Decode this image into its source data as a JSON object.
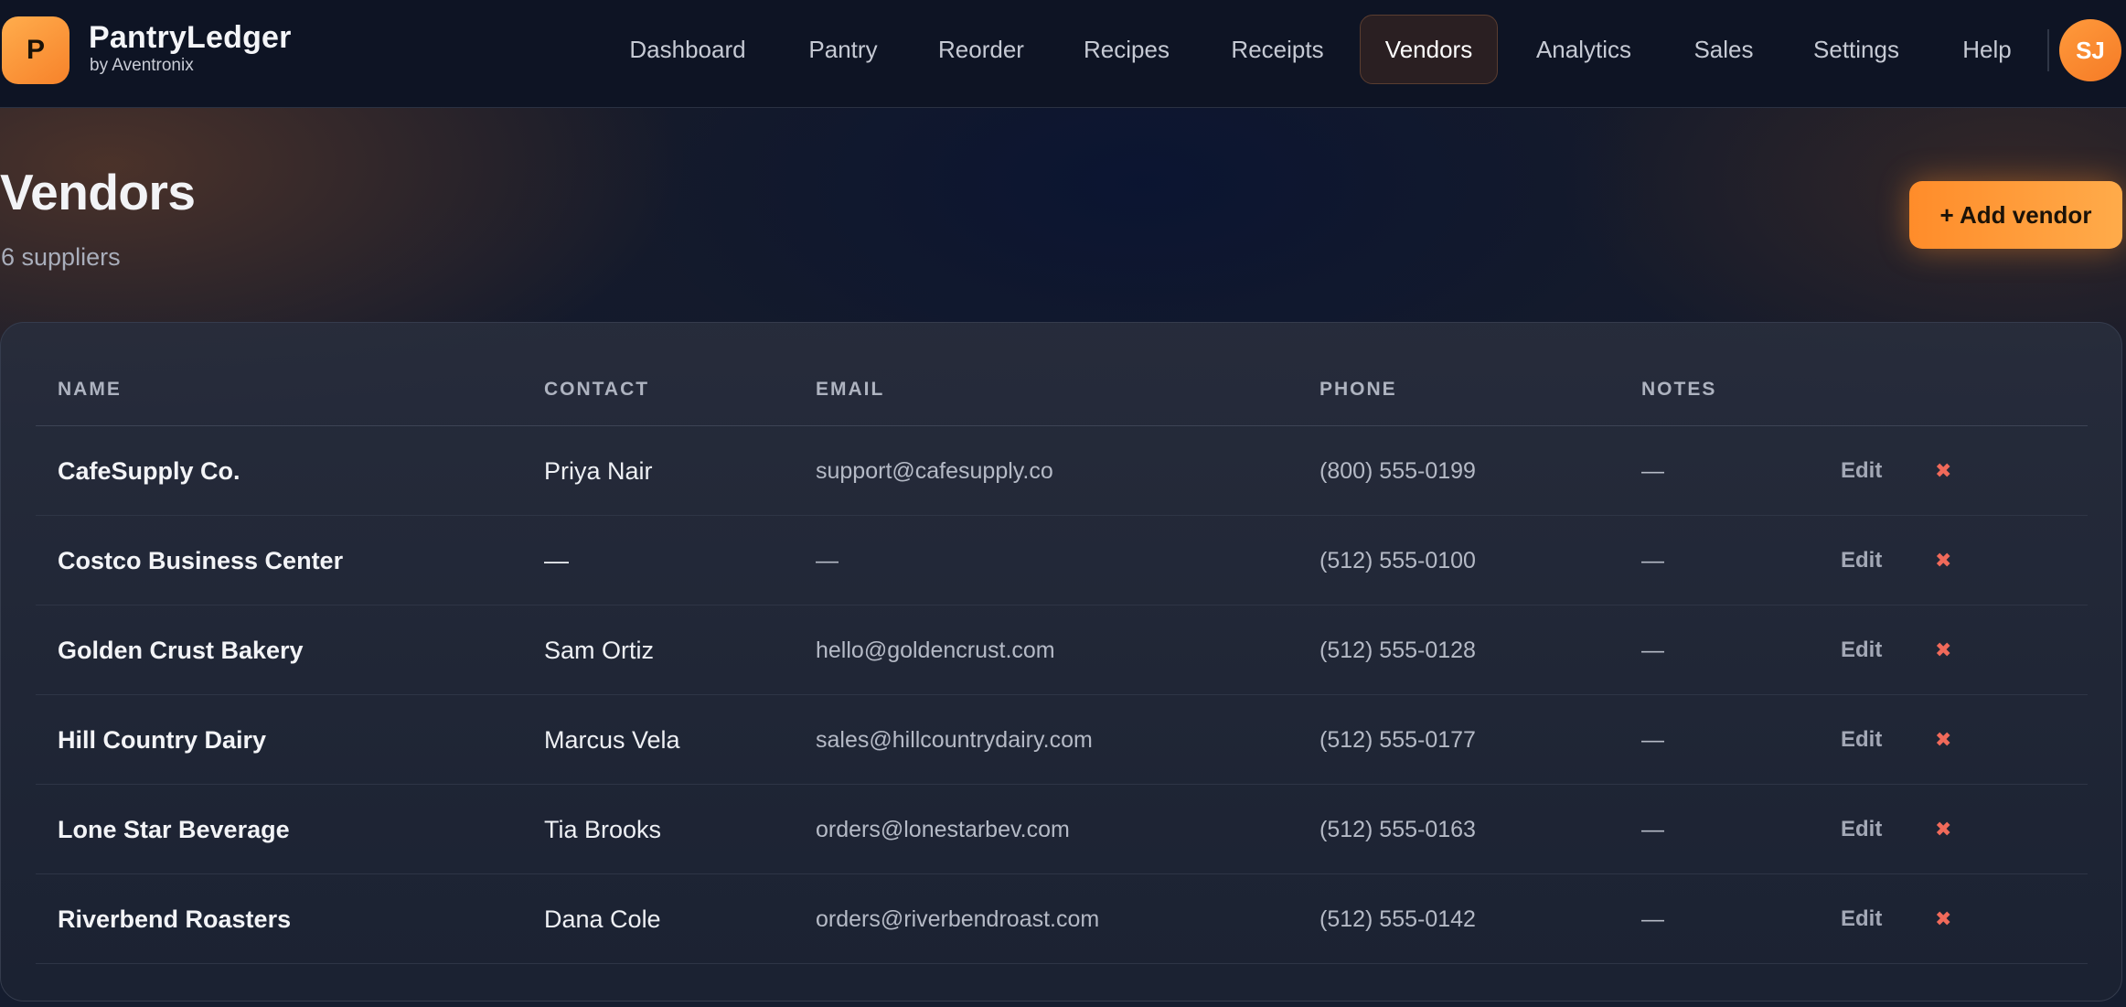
{
  "brand": {
    "logo_letter": "P",
    "name": "PantryLedger",
    "byline": "by Aventronix",
    "accent_color": "#f7822a"
  },
  "nav": {
    "items": [
      {
        "label": "Dashboard"
      },
      {
        "label": "Pantry"
      },
      {
        "label": "Reorder"
      },
      {
        "label": "Recipes"
      },
      {
        "label": "Receipts"
      },
      {
        "label": "Vendors",
        "active": true
      },
      {
        "label": "Analytics"
      },
      {
        "label": "Sales"
      },
      {
        "label": "Settings"
      },
      {
        "label": "Help"
      }
    ],
    "avatar_initials": "SJ"
  },
  "page": {
    "title": "Vendors",
    "subtitle": "6 suppliers",
    "add_button_label": "+ Add vendor"
  },
  "table": {
    "headers": {
      "name": "NAME",
      "contact": "CONTACT",
      "email": "EMAIL",
      "phone": "PHONE",
      "notes": "NOTES"
    },
    "edit_label": "Edit",
    "delete_icon": "close-icon",
    "delete_glyph": "✖",
    "rows": [
      {
        "name": "CafeSupply Co.",
        "contact": "Priya Nair",
        "email": "support@cafesupply.co",
        "phone": "(800) 555-0199",
        "notes": "—"
      },
      {
        "name": "Costco Business Center",
        "contact": "—",
        "email": "—",
        "phone": "(512) 555-0100",
        "notes": "—"
      },
      {
        "name": "Golden Crust Bakery",
        "contact": "Sam Ortiz",
        "email": "hello@goldencrust.com",
        "phone": "(512) 555-0128",
        "notes": "—"
      },
      {
        "name": "Hill Country Dairy",
        "contact": "Marcus Vela",
        "email": "sales@hillcountrydairy.com",
        "phone": "(512) 555-0177",
        "notes": "—"
      },
      {
        "name": "Lone Star Beverage",
        "contact": "Tia Brooks",
        "email": "orders@lonestarbev.com",
        "phone": "(512) 555-0163",
        "notes": "—"
      },
      {
        "name": "Riverbend Roasters",
        "contact": "Dana Cole",
        "email": "orders@riverbendroast.com",
        "phone": "(512) 555-0142",
        "notes": "—"
      }
    ]
  }
}
